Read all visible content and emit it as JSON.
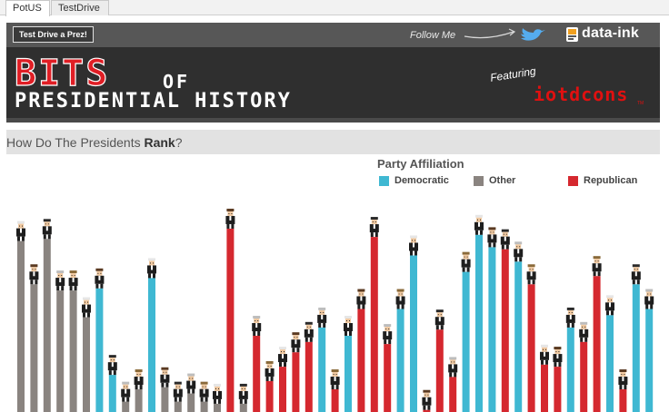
{
  "tabs": [
    {
      "label": "PotUS",
      "active": true
    },
    {
      "label": "TestDrive",
      "active": false
    }
  ],
  "banner": {
    "test_drive_button": "Test Drive a Prez!",
    "follow": "Follow Me",
    "brand": "data-ink",
    "title_bits": "BITS",
    "title_of": "OF",
    "title_line2": "PRESIDENTIAL HISTORY",
    "featuring": "Featuring",
    "featuring_brand": "iotdcons",
    "tm": "TM"
  },
  "section": {
    "title_prefix": "How Do The Presidents ",
    "title_strong": "Rank",
    "title_suffix": "?"
  },
  "colors": {
    "democratic": "#3fb8d2",
    "other": "#8a8480",
    "republican": "#d5282f",
    "banner_bg": "#2f2f2f",
    "banner_top": "#575757",
    "twitter": "#55acee"
  },
  "chart_data": {
    "type": "bar",
    "title": "Party Affiliation",
    "legend_position": "top-right",
    "grid": false,
    "legend": [
      {
        "name": "Democratic",
        "party": "D"
      },
      {
        "name": "Other",
        "party": "O"
      },
      {
        "name": "Republican",
        "party": "R"
      }
    ],
    "ylim": [
      0,
      100
    ],
    "values": [
      83,
      62,
      84,
      59,
      59,
      46,
      60,
      18,
      5,
      11,
      65,
      12,
      5,
      9,
      5,
      4,
      89,
      4,
      37,
      15,
      22,
      29,
      34,
      41,
      11,
      37,
      50,
      85,
      33,
      50,
      76,
      1,
      40,
      17,
      68,
      86,
      80,
      79,
      73,
      62,
      23,
      22,
      41,
      34,
      66,
      47,
      11,
      62,
      50
    ],
    "parties": [
      "O",
      "O",
      "O",
      "O",
      "O",
      "O",
      "D",
      "D",
      "O",
      "O",
      "D",
      "O",
      "O",
      "O",
      "O",
      "O",
      "R",
      "O",
      "R",
      "R",
      "R",
      "R",
      "R",
      "D",
      "R",
      "D",
      "R",
      "R",
      "R",
      "D",
      "D",
      "R",
      "R",
      "R",
      "D",
      "D",
      "D",
      "R",
      "D",
      "R",
      "R",
      "R",
      "D",
      "R",
      "R",
      "D",
      "R",
      "D",
      "D"
    ]
  }
}
